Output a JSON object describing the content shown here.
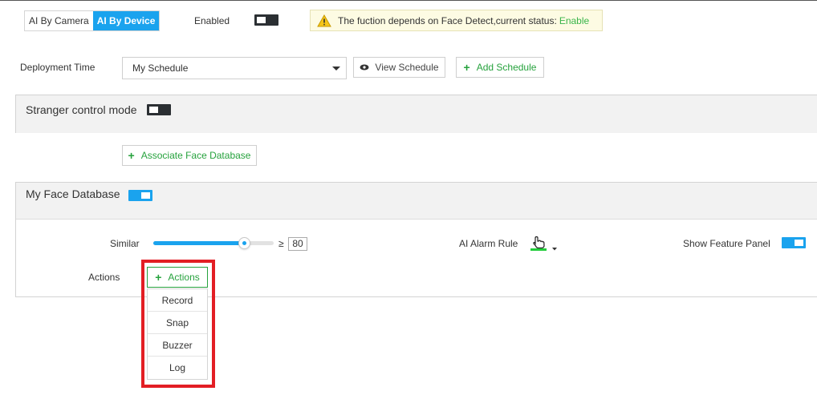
{
  "mode": {
    "options": [
      "AI By Camera",
      "AI By Device"
    ],
    "selected": "AI By Device"
  },
  "enabled": {
    "label": "Enabled",
    "state": "off"
  },
  "notice": {
    "text": "The fuction depends on Face Detect,current status:",
    "status": "Enable",
    "icon": "warning-icon"
  },
  "deployment": {
    "label": "Deployment Time",
    "schedule_value": "My Schedule",
    "view_button": "View Schedule",
    "add_button": "Add Schedule"
  },
  "stranger": {
    "title": "Stranger control mode",
    "state": "off"
  },
  "associate_button": "Associate Face Database",
  "face_db": {
    "title": "My Face Database",
    "state": "on",
    "similar_label": "Similar",
    "similar_symbol": "≥",
    "similar_value": "80",
    "similar_fraction": 0.75,
    "alarm_rule_label": "AI Alarm Rule",
    "alarm_rule_icon": "pointer-hand-icon",
    "show_feature_label": "Show Feature Panel",
    "show_feature_state": "on",
    "actions_label": "Actions",
    "actions_button": "Actions",
    "action_items": [
      "Record",
      "Snap",
      "Buzzer",
      "Log"
    ]
  },
  "colors": {
    "accent": "#1aa3ee",
    "green": "#26a23d",
    "highlight": "#e31e24"
  }
}
